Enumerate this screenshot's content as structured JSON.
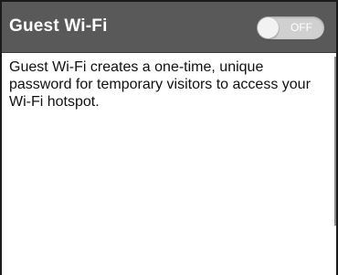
{
  "header": {
    "title": "Guest Wi-Fi",
    "toggle": {
      "state_label": "OFF",
      "on": false
    }
  },
  "body": {
    "description": "Guest Wi-Fi creates a one-time, unique password for temporary visitors to access your Wi-Fi hotspot."
  },
  "colors": {
    "header_bg": "#595959",
    "toggle_bg": "#d0d0d0",
    "text": "#111111"
  }
}
